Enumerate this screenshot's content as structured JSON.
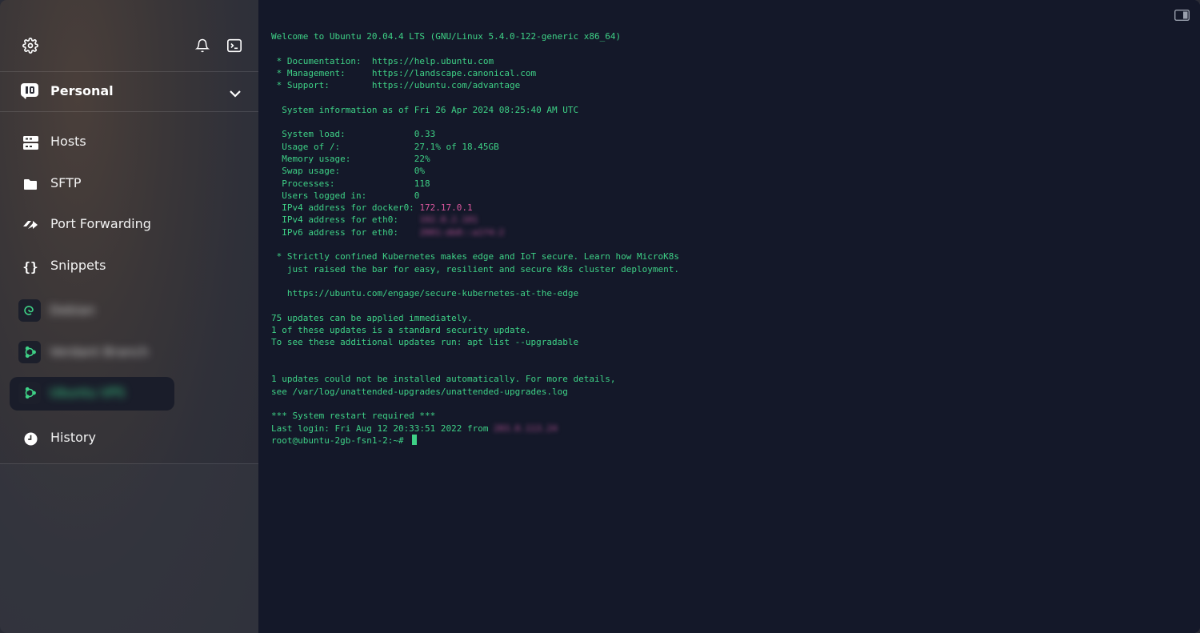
{
  "sidebar": {
    "vault_label": "Personal",
    "nav": [
      {
        "label": "Hosts",
        "icon": "hosts-icon"
      },
      {
        "label": "SFTP",
        "icon": "folder-icon"
      },
      {
        "label": "Port Forwarding",
        "icon": "port-forwarding-icon"
      },
      {
        "label": "Snippets",
        "icon": "braces-icon"
      }
    ],
    "hosts": [
      {
        "name": "Debian",
        "icon": "debian-icon"
      },
      {
        "name": "Verdant Branch",
        "icon": "ubuntu-icon"
      },
      {
        "name": "Ubuntu VPS",
        "icon": "ubuntu-icon",
        "active": true
      }
    ],
    "history_label": "History"
  },
  "terminal": {
    "lines": [
      "Welcome to Ubuntu 20.04.4 LTS (GNU/Linux 5.4.0-122-generic x86_64)",
      "",
      " * Documentation:  https://help.ubuntu.com",
      " * Management:     https://landscape.canonical.com",
      " * Support:        https://ubuntu.com/advantage",
      "",
      "  System information as of Fri 26 Apr 2024 08:25:40 AM UTC",
      "",
      "  System load:             0.33",
      "  Usage of /:              27.1% of 18.45GB",
      "  Memory usage:            22%",
      "  Swap usage:              0%",
      "  Processes:               118",
      "  Users logged in:         0"
    ],
    "docker_label": "  IPv4 address for docker0: ",
    "docker_ip": "172.17.0.1",
    "eth0_v4_label": "  IPv4 address for eth0:    ",
    "eth0_v4": "192.0.2.101",
    "eth0_v6_label": "  IPv6 address for eth0:    ",
    "eth0_v6": "2001:db8::a1f4:2",
    "lines2": [
      "",
      " * Strictly confined Kubernetes makes edge and IoT secure. Learn how MicroK8s",
      "   just raised the bar for easy, resilient and secure K8s cluster deployment.",
      "",
      "   https://ubuntu.com/engage/secure-kubernetes-at-the-edge",
      "",
      "75 updates can be applied immediately.",
      "1 of these updates is a standard security update.",
      "To see these additional updates run: apt list --upgradable",
      "",
      "",
      "1 updates could not be installed automatically. For more details,",
      "see /var/log/unattended-upgrades/unattended-upgrades.log",
      "",
      "*** System restart required ***"
    ],
    "last_login": "Last login: Fri Aug 12 20:33:51 2022 from ",
    "last_login_ip": "203.0.113.24",
    "prompt": "root@ubuntu-2gb-fsn1-2:~# "
  },
  "colors": {
    "terminal_text": "#3ed186",
    "terminal_bg": "#141829",
    "ip_highlight": "#d9569d"
  }
}
